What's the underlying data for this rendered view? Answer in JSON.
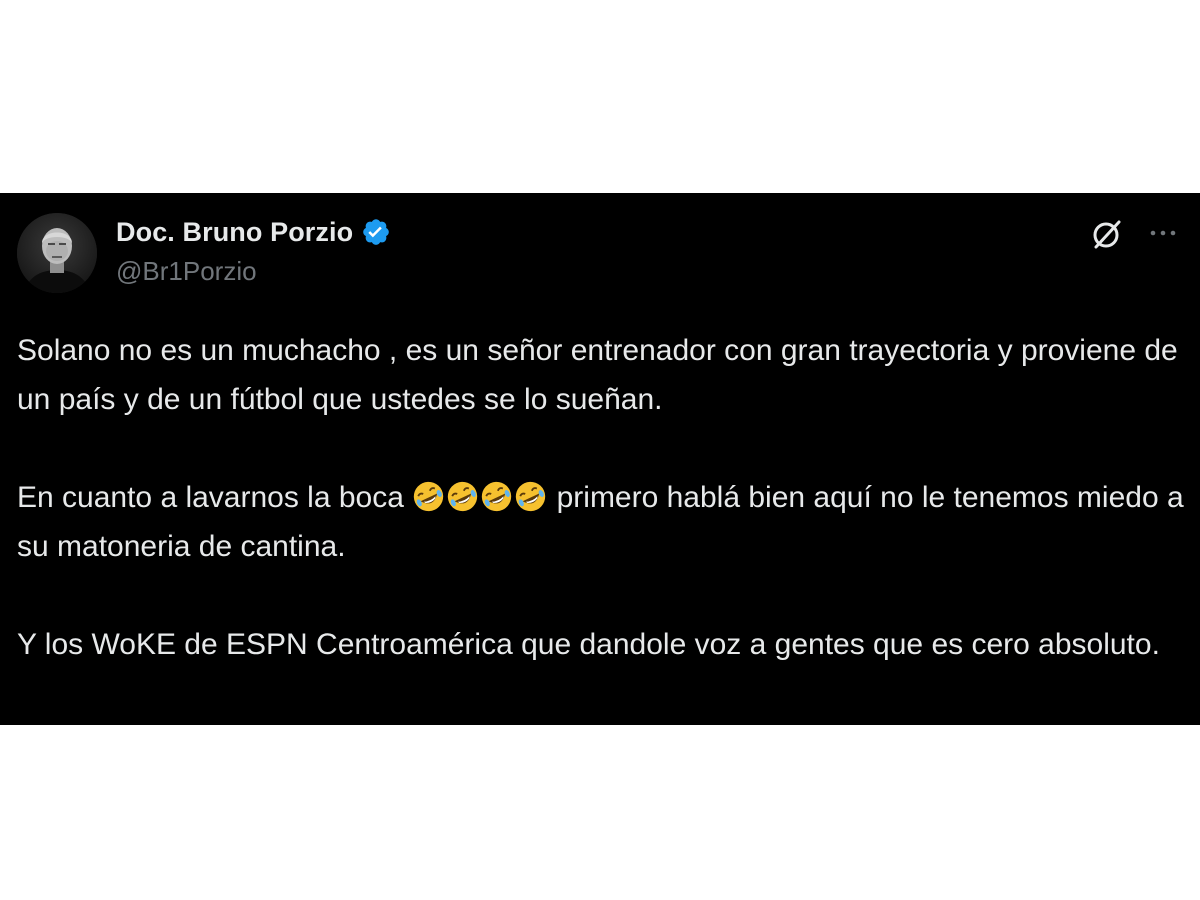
{
  "tweet": {
    "display_name": "Doc. Bruno Porzio",
    "handle": "@Br1Porzio",
    "verified": true,
    "paragraph1": "Solano no es un muchacho , es un señor entrenador con gran trayectoria y proviene de un país y de un fútbol que ustedes se lo sueñan.",
    "paragraph2_before": "En cuanto a lavarnos la boca ",
    "paragraph2_emojis": [
      "🤣",
      "🤣",
      "🤣",
      "🤣"
    ],
    "paragraph2_after": " primero hablá bien aquí no le tenemos miedo a su matoneria de cantina.",
    "paragraph3": "Y los WoKE de ESPN Centroamérica que dandole voz a gentes que es cero absoluto.",
    "icons": {
      "avatar": "profile-photo",
      "verified": "verified-badge-icon",
      "grok": "grok-icon",
      "more": "more-options-icon",
      "emoji": "rolling-on-floor-laughing-emoji"
    },
    "colors": {
      "background": "#000000",
      "text": "#e7e9ea",
      "secondary_text": "#71767b",
      "verified_blue": "#1d9bf0"
    }
  }
}
